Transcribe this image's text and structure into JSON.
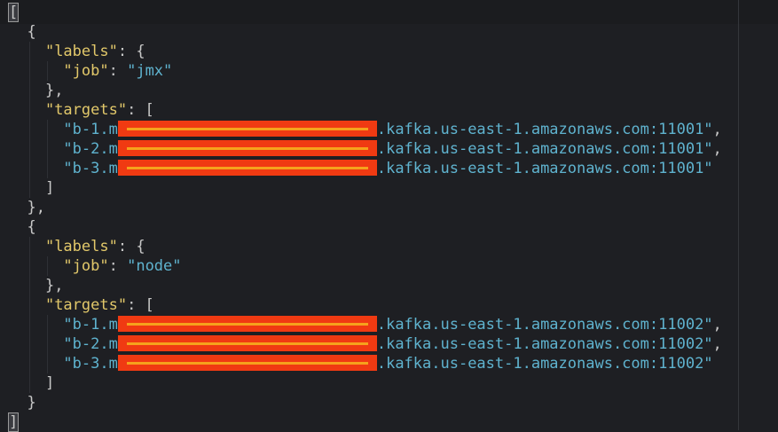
{
  "editor": {
    "lines": [
      {
        "indent": 0,
        "cursor": true,
        "tokens": [
          {
            "t": "punc",
            "v": "["
          }
        ]
      },
      {
        "indent": 1,
        "tokens": [
          {
            "t": "punc",
            "v": "{"
          }
        ]
      },
      {
        "indent": 2,
        "tokens": [
          {
            "t": "key",
            "v": "\"labels\""
          },
          {
            "t": "punc",
            "v": ": {"
          }
        ]
      },
      {
        "indent": 3,
        "tokens": [
          {
            "t": "key",
            "v": "\"job\""
          },
          {
            "t": "punc",
            "v": ": "
          },
          {
            "t": "str",
            "v": "\"jmx\""
          }
        ]
      },
      {
        "indent": 2,
        "tokens": [
          {
            "t": "punc",
            "v": "},"
          }
        ]
      },
      {
        "indent": 2,
        "tokens": [
          {
            "t": "key",
            "v": "\"targets\""
          },
          {
            "t": "punc",
            "v": ": ["
          }
        ]
      },
      {
        "indent": 3,
        "tokens": [
          {
            "t": "str",
            "v": "\"b-1.m"
          },
          {
            "t": "redact",
            "v": ""
          },
          {
            "t": "str",
            "v": ".kafka.us-east-1.amazonaws.com:11001\""
          },
          {
            "t": "punc",
            "v": ","
          }
        ]
      },
      {
        "indent": 3,
        "tokens": [
          {
            "t": "str",
            "v": "\"b-2.m"
          },
          {
            "t": "redact",
            "v": ""
          },
          {
            "t": "str",
            "v": ".kafka.us-east-1.amazonaws.com:11001\""
          },
          {
            "t": "punc",
            "v": ","
          }
        ]
      },
      {
        "indent": 3,
        "tokens": [
          {
            "t": "str",
            "v": "\"b-3.m"
          },
          {
            "t": "redact",
            "v": ""
          },
          {
            "t": "str",
            "v": ".kafka.us-east-1.amazonaws.com:11001\""
          }
        ]
      },
      {
        "indent": 2,
        "tokens": [
          {
            "t": "punc",
            "v": "]"
          }
        ]
      },
      {
        "indent": 1,
        "tokens": [
          {
            "t": "punc",
            "v": "},"
          }
        ]
      },
      {
        "indent": 1,
        "tokens": [
          {
            "t": "punc",
            "v": "{"
          }
        ]
      },
      {
        "indent": 2,
        "tokens": [
          {
            "t": "key",
            "v": "\"labels\""
          },
          {
            "t": "punc",
            "v": ": {"
          }
        ]
      },
      {
        "indent": 3,
        "tokens": [
          {
            "t": "key",
            "v": "\"job\""
          },
          {
            "t": "punc",
            "v": ": "
          },
          {
            "t": "str",
            "v": "\"node\""
          }
        ]
      },
      {
        "indent": 2,
        "tokens": [
          {
            "t": "punc",
            "v": "},"
          }
        ]
      },
      {
        "indent": 2,
        "tokens": [
          {
            "t": "key",
            "v": "\"targets\""
          },
          {
            "t": "punc",
            "v": ": ["
          }
        ]
      },
      {
        "indent": 3,
        "tokens": [
          {
            "t": "str",
            "v": "\"b-1.m"
          },
          {
            "t": "redact",
            "v": ""
          },
          {
            "t": "str",
            "v": ".kafka.us-east-1.amazonaws.com:11002\""
          },
          {
            "t": "punc",
            "v": ","
          }
        ]
      },
      {
        "indent": 3,
        "tokens": [
          {
            "t": "str",
            "v": "\"b-2.m"
          },
          {
            "t": "redact",
            "v": ""
          },
          {
            "t": "str",
            "v": ".kafka.us-east-1.amazonaws.com:11002\""
          },
          {
            "t": "punc",
            "v": ","
          }
        ]
      },
      {
        "indent": 3,
        "tokens": [
          {
            "t": "str",
            "v": "\"b-3.m"
          },
          {
            "t": "redact",
            "v": ""
          },
          {
            "t": "str",
            "v": ".kafka.us-east-1.amazonaws.com:11002\""
          }
        ]
      },
      {
        "indent": 2,
        "tokens": [
          {
            "t": "punc",
            "v": "]"
          }
        ]
      },
      {
        "indent": 1,
        "tokens": [
          {
            "t": "punc",
            "v": "}"
          }
        ]
      },
      {
        "indent": 0,
        "cursor": true,
        "tokens": [
          {
            "t": "punc",
            "v": "]"
          }
        ]
      }
    ]
  }
}
